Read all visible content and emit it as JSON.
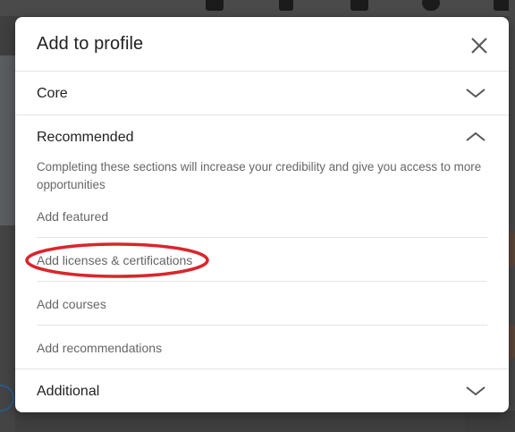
{
  "modal": {
    "title": "Add to profile",
    "close_icon": "close-icon"
  },
  "sections": {
    "core": {
      "label": "Core",
      "state": "collapsed"
    },
    "recommended": {
      "label": "Recommended",
      "state": "expanded",
      "description": "Completing these sections will increase your credibility and give you access to more opportunities",
      "items": [
        {
          "label": "Add featured"
        },
        {
          "label": "Add licenses & certifications",
          "annotated": true
        },
        {
          "label": "Add courses"
        },
        {
          "label": "Add recommendations"
        }
      ]
    },
    "additional": {
      "label": "Additional",
      "state": "collapsed"
    }
  },
  "annotation": {
    "color": "#d9262c"
  },
  "colors": {
    "text_primary": "#222222",
    "text_secondary": "#666666",
    "divider": "#e3e3e3"
  }
}
